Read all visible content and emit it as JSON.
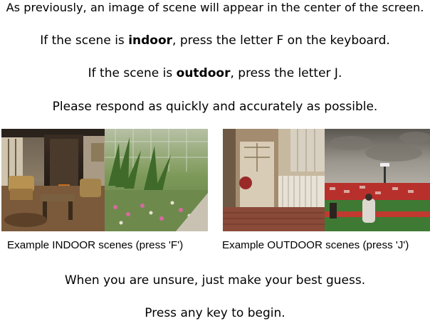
{
  "instructions": {
    "line1": "As previously, an image of scene will appear in the center of the screen.",
    "indoor_prefix": "If the scene is ",
    "indoor_word": "indoor",
    "indoor_suffix": ", press the letter F on the keyboard.",
    "outdoor_prefix": "If the scene is ",
    "outdoor_word": "outdoor",
    "outdoor_suffix": ", press the letter J.",
    "respond": "Please respond as quickly and accurately as possible."
  },
  "examples": {
    "indoor_caption": "Example INDOOR scenes (press 'F')",
    "outdoor_caption": "Example OUTDOOR scenes (press 'J')"
  },
  "footer": {
    "guess": "When you are unsure, just make your best guess.",
    "begin": "Press any key to begin."
  }
}
